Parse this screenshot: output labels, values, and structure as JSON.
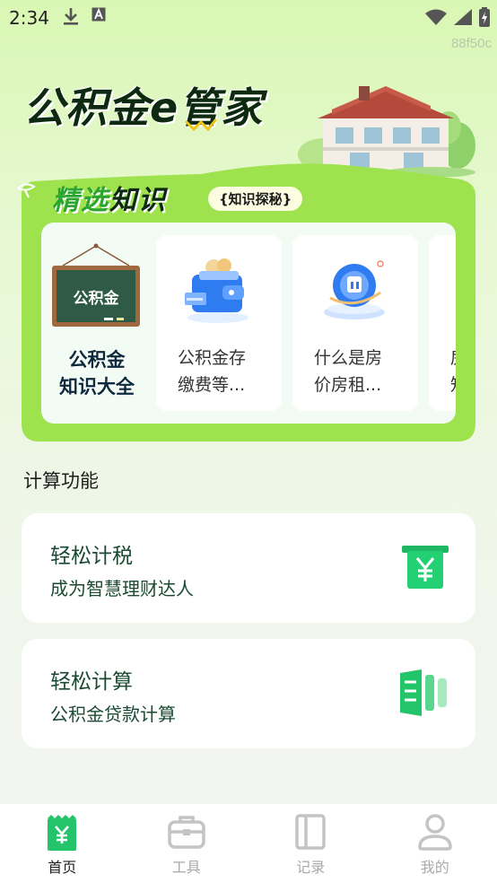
{
  "status_bar": {
    "time": "2:34"
  },
  "watermark": "88f50c",
  "app_title": "公积金e管家",
  "knowledge": {
    "heading_part1": "精选",
    "heading_part2": "知识",
    "badge": "{知识探秘}",
    "first_card": {
      "board_text": "公积金",
      "title_line1": "公积金",
      "title_line2": "知识大全"
    },
    "cards": [
      {
        "line1": "公积金存",
        "line2": "缴费等...",
        "icon": "wallet-icon"
      },
      {
        "line1": "什么是房",
        "line2": "价房租...",
        "icon": "globe-icon"
      },
      {
        "line1": "房",
        "line2": "知",
        "icon": "none"
      }
    ]
  },
  "section_title": "计算功能",
  "functions": [
    {
      "title": "轻松计税",
      "subtitle": "成为智慧理财达人",
      "icon": "yuan-receipt-icon"
    },
    {
      "title": "轻松计算",
      "subtitle": "公积金贷款计算",
      "icon": "calculator-bars-icon"
    }
  ],
  "tabs": [
    {
      "label": "首页",
      "active": true,
      "icon": "home-yuan-icon"
    },
    {
      "label": "工具",
      "active": false,
      "icon": "toolbox-icon"
    },
    {
      "label": "记录",
      "active": false,
      "icon": "book-icon"
    },
    {
      "label": "我的",
      "active": false,
      "icon": "user-icon"
    }
  ],
  "colors": {
    "accent_green": "#23c46a",
    "panel_green": "#9ee24e",
    "title_dark": "#0d2a10"
  }
}
